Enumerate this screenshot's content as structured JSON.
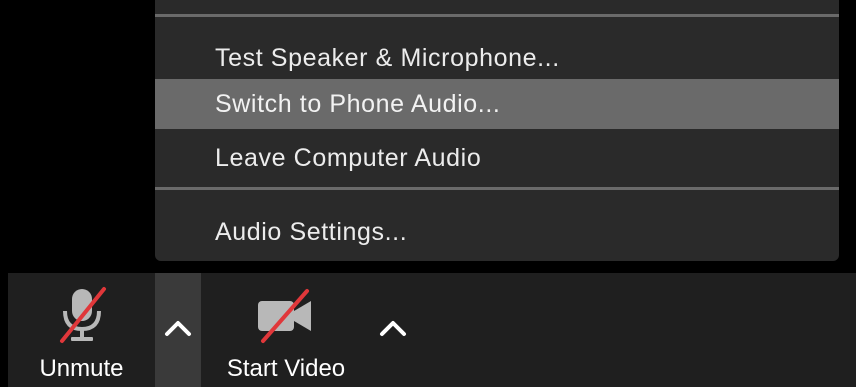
{
  "audio_menu": {
    "items": [
      {
        "label": "Test Speaker & Microphone..."
      },
      {
        "label": "Switch to Phone Audio...",
        "highlighted": true
      },
      {
        "label": "Leave Computer Audio"
      },
      {
        "label": "Audio Settings..."
      }
    ]
  },
  "toolbar": {
    "unmute": {
      "label": "Unmute",
      "icon": "muted-microphone-icon"
    },
    "audio_options": {
      "icon": "chevron-up-icon",
      "active": true
    },
    "start_video": {
      "label": "Start Video",
      "icon": "video-off-icon"
    },
    "video_options": {
      "icon": "chevron-up-icon"
    }
  },
  "colors": {
    "background": "#000000",
    "menu_bg": "#2a2a2a",
    "menu_highlight": "#6a6a6a",
    "toolbar_bg": "#1f1f1f",
    "slash_red": "#e0373a"
  }
}
